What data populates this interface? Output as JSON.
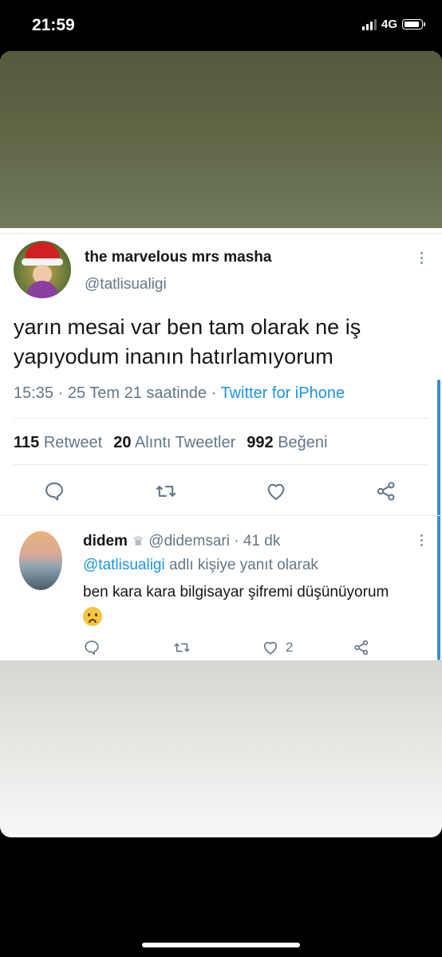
{
  "status_bar": {
    "time": "21:59",
    "network": "4G",
    "signal_bars": 4,
    "signal_bars_active": 3
  },
  "tweet": {
    "author_name": "the marvelous mrs masha",
    "author_handle": "@tatlisualigi",
    "text": "yarın mesai var ben tam olarak ne iş yapıyodum inanın hatırlamıyorum",
    "meta_time": "15:35 · 25 Tem 21 saatinde · ",
    "meta_source": "Twitter for iPhone",
    "stats": {
      "retweets_count": "115",
      "retweets_label": "Retweet",
      "quotes_count": "20",
      "quotes_label": "Alıntı Tweetler",
      "likes_count": "992",
      "likes_label": "Beğeni"
    }
  },
  "reply": {
    "author_name": "didem",
    "crown": "♛",
    "author_handle": "@didemsari",
    "time": "· 41 dk",
    "reply_to_mention": "@tatlisualigi",
    "reply_to_suffix": " adlı kişiye yanıt olarak",
    "text": "ben kara kara bilgisayar şifremi düşünüyorum",
    "like_count": "2"
  },
  "colors": {
    "accent": "#1b95e0",
    "secondary_text": "#657786",
    "primary_text": "#14171a"
  },
  "icons": [
    "reply-icon",
    "retweet-icon",
    "like-icon",
    "share-icon",
    "more-icon"
  ]
}
